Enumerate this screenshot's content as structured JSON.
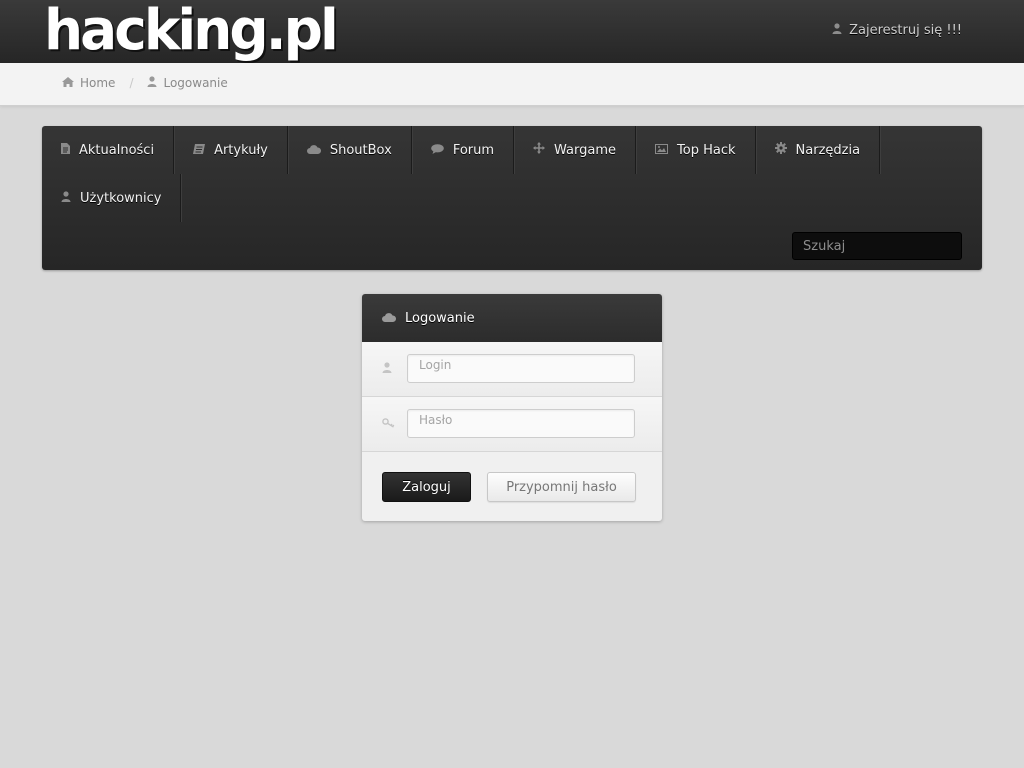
{
  "header": {
    "logo_text": "hacking.pl",
    "register_label": "Zajerestruj się !!!"
  },
  "breadcrumb": {
    "items": [
      {
        "label": "Home",
        "icon": "home-icon"
      },
      {
        "label": "Logowanie",
        "icon": "user-icon"
      }
    ],
    "separator": "/"
  },
  "nav": {
    "items": [
      {
        "label": "Aktualności",
        "icon": "file-icon"
      },
      {
        "label": "Artykuły",
        "icon": "book-icon"
      },
      {
        "label": "ShoutBox",
        "icon": "cloud-icon"
      },
      {
        "label": "Forum",
        "icon": "comment-icon"
      },
      {
        "label": "Wargame",
        "icon": "move-icon"
      },
      {
        "label": "Top Hack",
        "icon": "picture-icon"
      },
      {
        "label": "Narzędzia",
        "icon": "cog-icon"
      },
      {
        "label": "Użytkownicy",
        "icon": "user-icon"
      }
    ],
    "search_placeholder": "Szukaj"
  },
  "login": {
    "title": "Logowanie",
    "login_placeholder": "Login",
    "password_placeholder": "Hasło",
    "submit_label": "Zaloguj",
    "remind_label": "Przypomnij hasło"
  },
  "colors": {
    "page_bg": "#d9d9d9",
    "topbar": "#2e2e2e",
    "nav_bg": "#2d2d2d",
    "search_bg": "#0d0d0d",
    "primary_button": "#222222"
  }
}
